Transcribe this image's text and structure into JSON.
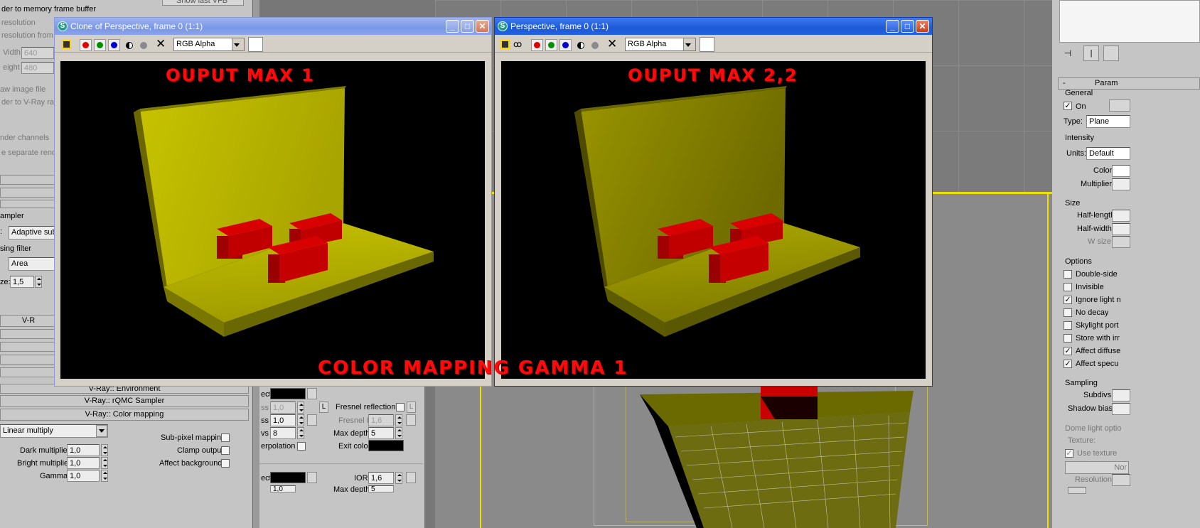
{
  "left_panel": {
    "show_last_vfb": "Show last VFB",
    "render_to_memory": "der to memory frame buffer",
    "resolution": "resolution",
    "resolution_from_max": "resolution from M",
    "width_label": "Vidth",
    "width_value": "640",
    "height_label": "eight",
    "height_value": "480",
    "raw_image_file": "aw image file",
    "render_to_vray_raw": "der to V-Ray raw",
    "render_channels": "nder channels",
    "separate_render": "e separate render",
    "sampler_label": "ampler",
    "sampler_type_prefix": ":",
    "sampler_value": "Adaptive sub",
    "filter_label": "sing filter",
    "filter_value": "Area",
    "size_label": "ze:",
    "size_value": "1,5",
    "vr_rollout": "V-R",
    "env_rollout": "V-Ray:: Environment",
    "rqmc_rollout": "V-Ray:: rQMC Sampler",
    "colormap_rollout": "V-Ray:: Color mapping",
    "colormap_type": "Linear multiply",
    "dark_mult_label": "Dark multiplier:",
    "dark_mult_value": "1,0",
    "bright_mult_label": "Bright multiplier:",
    "bright_mult_value": "1,0",
    "gamma_label": "Gamma:",
    "gamma_value": "1,0",
    "subpixel_label": "Sub-pixel mapping",
    "clamp_label": "Clamp output",
    "affect_bg_label": "Affect background"
  },
  "material_panel": {
    "affect1": "ect",
    "gloss1_label": "ss",
    "gloss1_value": "1,0",
    "gloss2_label": "ss",
    "gloss2_value": "1,0",
    "subdivs_label": "vs",
    "subdivs_value": "8",
    "interp_label": "erpolation",
    "fresnel_label": "Fresnel reflections",
    "fresnel_ior_label": "Fresnel IOR",
    "fresnel_ior_value": "1,6",
    "maxdepth_label": "Max depth",
    "maxdepth_value": "5",
    "exit_color_label": "Exit color",
    "l_label": "L",
    "affect2": "ect",
    "ior_label": "IOR",
    "ior_value": "1,6",
    "bottom_value": "1,0",
    "bottom_maxdepth_label": "Max depth",
    "bottom_maxdepth_value": "5"
  },
  "right_panel": {
    "params_title": "Param",
    "general_label": "General",
    "on_label": "On",
    "type_label": "Type:",
    "type_value": "Plane",
    "intensity_label": "Intensity",
    "units_label": "Units:",
    "units_value": "Default",
    "color_label": "Color:",
    "multiplier_label": "Multiplier:",
    "size_label": "Size",
    "half_length_label": "Half-length:",
    "half_width_label": "Half-width:",
    "wsize_label": "W size",
    "options_label": "Options",
    "double_sided": "Double-side",
    "invisible": "Invisible",
    "ignore_light": "Ignore light n",
    "no_decay": "No decay",
    "skylight_portal": "Skylight port",
    "store_with_irr": "Store with irr",
    "affect_diffuse": "Affect diffuse",
    "affect_specular": "Affect specu",
    "sampling_label": "Sampling",
    "subdivs_label": "Subdivs:",
    "shadow_bias_label": "Shadow bias:",
    "dome_label": "Dome light optio",
    "texture_label": "Texture:",
    "use_texture": "Use texture",
    "none_btn": "Nor",
    "resolution_label": "Resolution:"
  },
  "window_left": {
    "title": "Clone of Perspective, frame 0 (1:1)",
    "channel": "RGB Alpha",
    "overlay_text": "OUPUT MAX 1"
  },
  "window_right": {
    "title": "Perspective, frame 0 (1:1)",
    "channel": "RGB Alpha",
    "overlay_text": "OUPUT MAX 2,2"
  },
  "caption": "COLOR MAPPING GAMMA 1",
  "colors": {
    "titlebar_active": "#1d5ad8",
    "titlebar_inactive": "#7a97e6",
    "floor": "#b5b000",
    "box_red": "#c80000",
    "label_red": "#ff0a0a",
    "selection_yellow": "#f0e000"
  }
}
